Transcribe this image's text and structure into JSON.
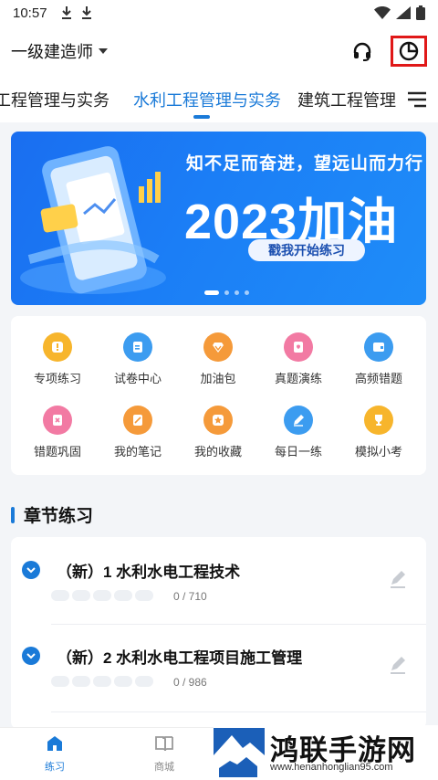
{
  "status": {
    "time": "10:57"
  },
  "header": {
    "title": "一级建造师"
  },
  "tabs": [
    {
      "label": "工程管理与实务"
    },
    {
      "label": "水利工程管理与实务"
    },
    {
      "label": "建筑工程管理与"
    }
  ],
  "banner": {
    "slogan": "知不足而奋进，望远山而力行",
    "headline": "2023加油",
    "cta": "戳我开始练习",
    "page_index": 1,
    "page_count": 4
  },
  "features": [
    {
      "label": "专项练习",
      "icon": "special-practice-icon",
      "color": "#f7b52c"
    },
    {
      "label": "试卷中心",
      "icon": "paper-center-icon",
      "color": "#3c9cf0"
    },
    {
      "label": "加油包",
      "icon": "boost-pack-icon",
      "color": "#f59a3a"
    },
    {
      "label": "真题演练",
      "icon": "past-exam-icon",
      "color": "#f27aa3"
    },
    {
      "label": "高频错题",
      "icon": "frequent-mistakes-icon",
      "color": "#3c9cf0"
    },
    {
      "label": "错题巩固",
      "icon": "mistake-review-icon",
      "color": "#f27aa3"
    },
    {
      "label": "我的笔记",
      "icon": "notes-icon",
      "color": "#f59a3a"
    },
    {
      "label": "我的收藏",
      "icon": "favorites-icon",
      "color": "#f59a3a"
    },
    {
      "label": "每日一练",
      "icon": "daily-practice-icon",
      "color": "#3c9cf0"
    },
    {
      "label": "模拟小考",
      "icon": "mock-exam-icon",
      "color": "#f7b52c"
    }
  ],
  "section": {
    "title": "章节练习"
  },
  "chapters": [
    {
      "name": "（新）1 水利水电工程技术",
      "progress": "0 / 710"
    },
    {
      "name": "（新）2 水利水电工程项目施工管理",
      "progress": "0 / 986"
    }
  ],
  "bottom_nav": [
    {
      "label": "练习",
      "active": true
    },
    {
      "label": "商城",
      "active": false
    }
  ],
  "watermark": {
    "text": "鸿联手游网",
    "url": "www.henanhonglian95.com"
  }
}
